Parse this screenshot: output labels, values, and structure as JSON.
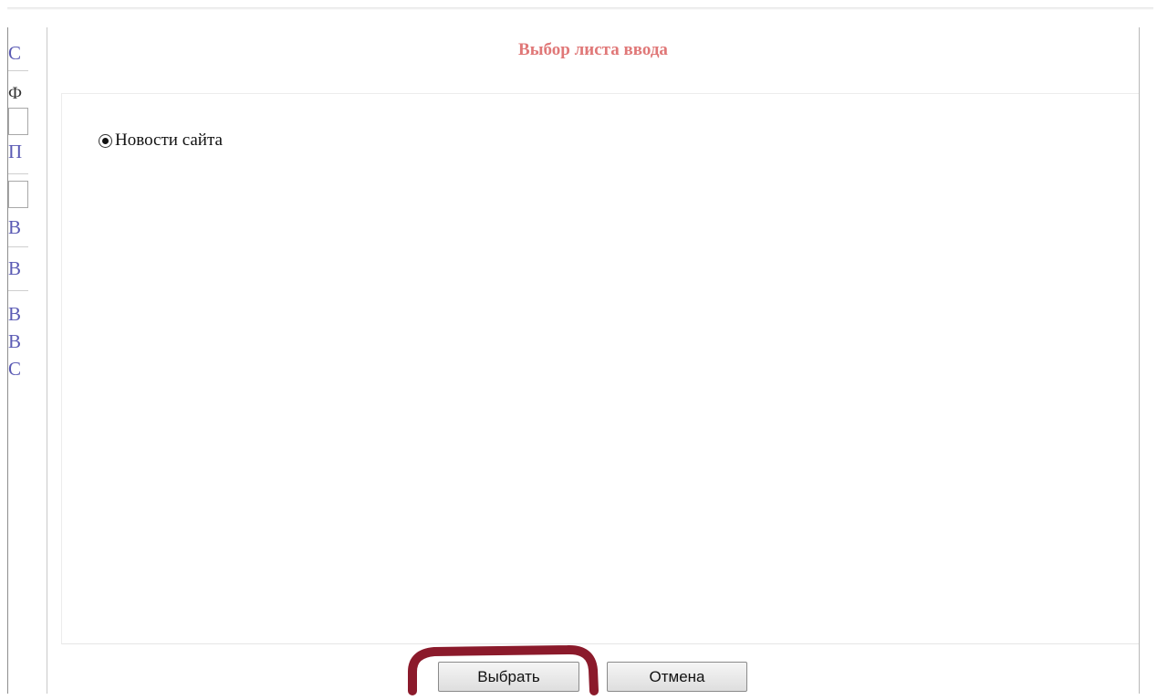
{
  "dialog": {
    "title": "Выбор листа ввода",
    "options": [
      {
        "label": "Новости сайта",
        "selected": true
      }
    ],
    "buttons": {
      "select_label": "Выбрать",
      "cancel_label": "Отмена"
    }
  },
  "background_page": {
    "partial_letters": [
      "C",
      "Ф",
      "П",
      "В",
      "В",
      "В",
      "В",
      "С"
    ]
  },
  "colors": {
    "title": "#e07878",
    "link": "#5a5ab4",
    "annotation": "#8b1a2b"
  }
}
